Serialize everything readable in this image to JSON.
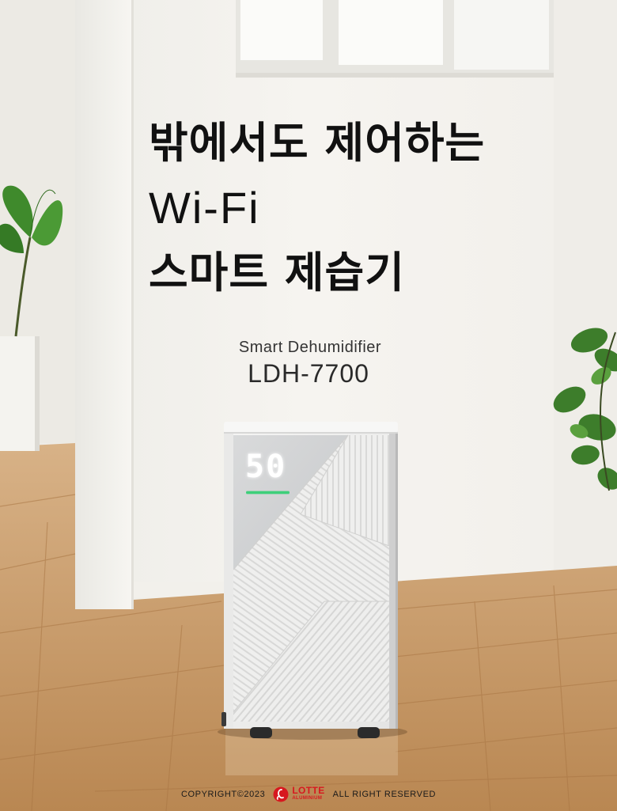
{
  "headline": {
    "line1": "밖에서도 제어하는",
    "line2": "Wi-Fi",
    "line3": "스마트 제습기"
  },
  "product": {
    "category": "Smart Dehumidifier",
    "model": "LDH-7700",
    "display_value": "50"
  },
  "footer": {
    "copyright": "COPYRIGHT©2023",
    "brand_name": "LOTTE",
    "brand_sub": "ALUMINIUM",
    "rights": "ALL RIGHT RESERVED"
  },
  "colors": {
    "brand_red": "#d7181f",
    "wall": "#f3f0ea",
    "floor": "#c99a66",
    "device_white": "#f1f1f1",
    "indicator_green": "#3ecf7a"
  },
  "icons": [
    "lotte-logo-icon"
  ]
}
